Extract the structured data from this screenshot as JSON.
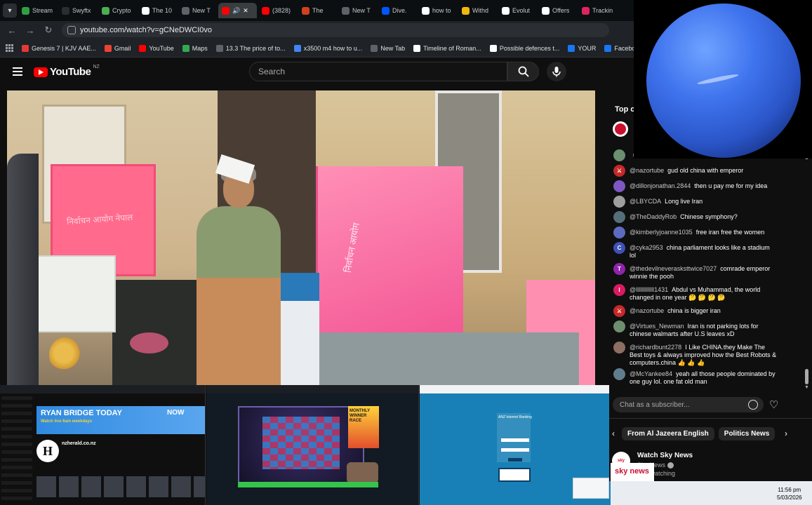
{
  "browser": {
    "tabs": [
      {
        "label": "Stream",
        "color": "#2ea043"
      },
      {
        "label": "Swyftx",
        "color": "#2b2d31"
      },
      {
        "label": "Crypto",
        "color": "#4caf50"
      },
      {
        "label": "The 10",
        "color": "#ffffff"
      },
      {
        "label": "New T",
        "color": "#5f6368"
      },
      {
        "label": "",
        "color": "#ff0000"
      },
      {
        "label": "(3828)",
        "color": "#ff0000"
      },
      {
        "label": "The",
        "color": "#d0421b"
      },
      {
        "label": "New T",
        "color": "#5f6368"
      },
      {
        "label": "Dive.",
        "color": "#0057ff"
      },
      {
        "label": "how to",
        "color": "#ffffff"
      },
      {
        "label": "Withd",
        "color": "#f0b90b"
      },
      {
        "label": "Evolut",
        "color": "#ffffff"
      },
      {
        "label": "Offers",
        "color": "#ffffff"
      },
      {
        "label": "Trackin",
        "color": "#e0245e"
      }
    ],
    "url": "youtube.com/watch?v=gCNeDWCI0vo",
    "bookmarks": [
      {
        "label": "Genesis 7 | KJV AAE...",
        "color": "#e53935"
      },
      {
        "label": "Gmail",
        "color": "#ea4335"
      },
      {
        "label": "YouTube",
        "color": "#ff0000"
      },
      {
        "label": "Maps",
        "color": "#34a853"
      },
      {
        "label": "13.3 The price of to...",
        "color": "#5f6368"
      },
      {
        "label": "x3500 m4 how to u...",
        "color": "#4285f4"
      },
      {
        "label": "New Tab",
        "color": "#5f6368"
      },
      {
        "label": "Timeline of Roman...",
        "color": "#ffffff"
      },
      {
        "label": "Possible defences t...",
        "color": "#ffffff"
      },
      {
        "label": "YOUR",
        "color": "#1877f2"
      },
      {
        "label": "Facebook green",
        "color": "#1877f2"
      }
    ]
  },
  "youtube": {
    "logo_text": "YouTube",
    "region": "NZ",
    "search_placeholder": "Search"
  },
  "video": {
    "booth_left_text": "निर्वाचन आयोग\nनेपाल",
    "booth_right_text": "निर्वाचन आयोग"
  },
  "chat": {
    "header": "Top c",
    "messages": [
      {
        "author": "",
        "text": "unfortunately.",
        "avatar_color": "#6b8f71",
        "initial": ""
      },
      {
        "author": "@nazortube",
        "text": "gud old china with emperor",
        "avatar_color": "#c62828",
        "initial": "⚔"
      },
      {
        "author": "@dillonjonathan.2844",
        "text": "then u pay me for my idea",
        "avatar_color": "#7e57c2",
        "initial": ""
      },
      {
        "author": "@LBYCDA",
        "text": "Long live Iran",
        "avatar_color": "#9e9e9e",
        "initial": ""
      },
      {
        "author": "@TheDaddyRob",
        "text": "Chinese symphony?",
        "avatar_color": "#546e7a",
        "initial": ""
      },
      {
        "author": "@kimberlyjoanne1035",
        "text": "free iran free the women",
        "avatar_color": "#5c6bc0",
        "initial": ""
      },
      {
        "author": "@cyka2953",
        "text": "china parliament looks like a stadium lol",
        "avatar_color": "#3f51b5",
        "initial": "C"
      },
      {
        "author": "@thedevilneverasksttwice7027",
        "text": "comrade emperor winnie the pooh",
        "avatar_color": "#8e24aa",
        "initial": "T"
      },
      {
        "author": "@lllllllllllll1431",
        "text": "Abdul vs Muhammad, the world changed in one year 🤔 🤔 🤔 🤔",
        "avatar_color": "#d81b60",
        "initial": "I"
      },
      {
        "author": "@nazortube",
        "text": "china is bigger iran",
        "avatar_color": "#c62828",
        "initial": "⚔"
      },
      {
        "author": "@Virtues_Newman",
        "text": "Iran is not parking lots for chinese walmarts after U.S leaves xD",
        "avatar_color": "#6d8f6e",
        "initial": ""
      },
      {
        "author": "@richardbunt2278",
        "text": "I Like CHINA.they Make The Best toys & always improved how the Best Robots & computers.china 👍 👍 👍",
        "avatar_color": "#8d6e63",
        "initial": ""
      },
      {
        "author": "@McYankee84",
        "text": "yeah all those people dominated by one guy lol. one fat old man",
        "avatar_color": "#607d8b",
        "initial": ""
      }
    ],
    "input_placeholder": "Chat as a subscriber...",
    "chips": [
      "From Al Jazeera English",
      "Politics News"
    ],
    "recommendation": {
      "title": "Watch Sky News",
      "channel": "Sky News",
      "views": "10K watching",
      "logo_text": "sky news"
    }
  },
  "thumbnails": {
    "t1": {
      "banner_title": "RYAN BRIDGE TODAY",
      "banner_sub": "Watch live 6am weekdays",
      "banner_now": "NOW",
      "logo": "H",
      "site": "nzherald.co.nz"
    },
    "t2": {
      "ad_text": "MONTHLY WINNER RACE"
    },
    "t3": {
      "title": "ANZ Internet Banking"
    }
  },
  "taskbar": {
    "time": "11:56 pm",
    "date": "5/03/2026"
  }
}
